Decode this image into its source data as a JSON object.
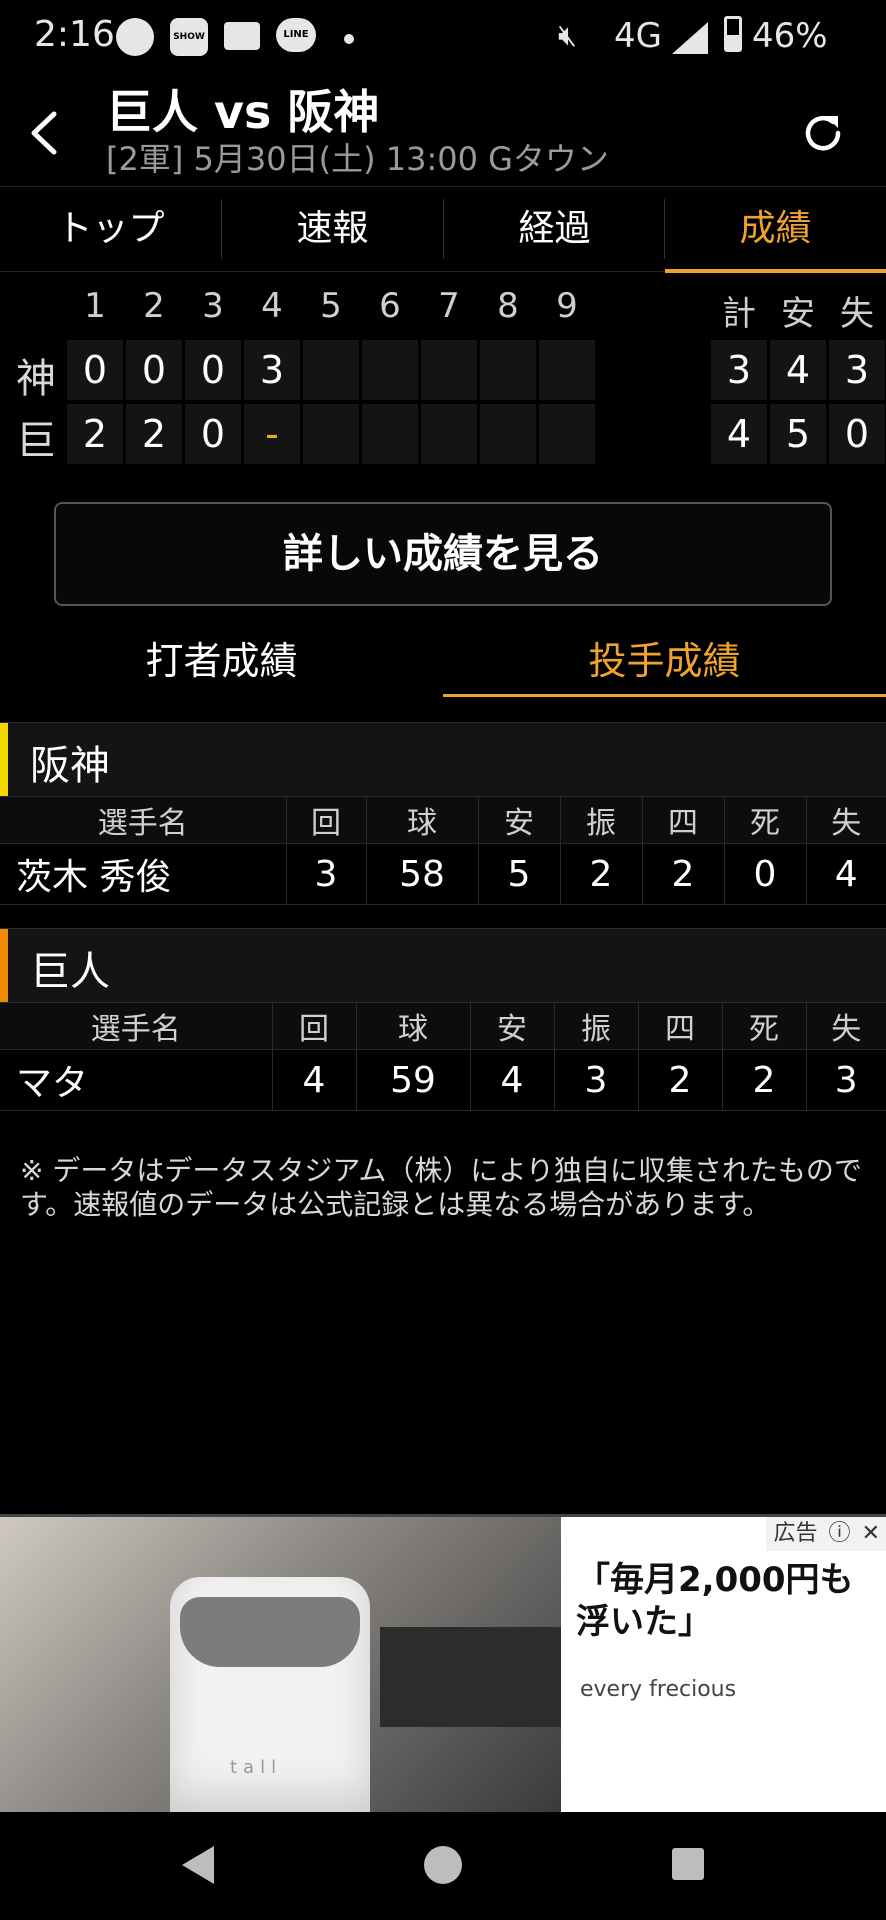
{
  "status_bar": {
    "time": "2:16",
    "network": "4G",
    "battery": "46%",
    "app_badges": [
      "SHOW ROOM",
      "au",
      "LINE"
    ]
  },
  "header": {
    "title": "巨人 vs 阪神",
    "subtitle": "[2軍] 5月30日(土) 13:00 Gタウン"
  },
  "tabs": [
    {
      "label": "トップ",
      "active": false
    },
    {
      "label": "速報",
      "active": false
    },
    {
      "label": "経過",
      "active": false
    },
    {
      "label": "成績",
      "active": true
    }
  ],
  "scoreboard": {
    "innings": [
      "1",
      "2",
      "3",
      "4",
      "5",
      "6",
      "7",
      "8",
      "9"
    ],
    "totals_headers": [
      "計",
      "安",
      "失"
    ],
    "rows": [
      {
        "team": "神",
        "scores": [
          "0",
          "0",
          "0",
          "3",
          "",
          "",
          "",
          "",
          ""
        ],
        "totals": [
          "3",
          "4",
          "3"
        ]
      },
      {
        "team": "巨",
        "scores": [
          "2",
          "2",
          "0",
          "-",
          "",
          "",
          "",
          "",
          ""
        ],
        "totals": [
          "4",
          "5",
          "0"
        ]
      }
    ]
  },
  "detail_button": "詳しい成績を見る",
  "sub_tabs": [
    {
      "label": "打者成績",
      "active": false
    },
    {
      "label": "投手成績",
      "active": true
    }
  ],
  "pitching": [
    {
      "team": "阪神",
      "color": "#f5d800",
      "headers": [
        "選手名",
        "回",
        "球",
        "安",
        "振",
        "四",
        "死",
        "失"
      ],
      "rows": [
        {
          "name": "茨木 秀俊",
          "stats": [
            "3",
            "58",
            "5",
            "2",
            "2",
            "0",
            "4"
          ]
        }
      ]
    },
    {
      "team": "巨人",
      "color": "#f08a00",
      "headers": [
        "選手名",
        "回",
        "球",
        "安",
        "振",
        "四",
        "死",
        "失"
      ],
      "rows": [
        {
          "name": "マタ",
          "stats": [
            "4",
            "59",
            "4",
            "3",
            "2",
            "2",
            "3"
          ]
        }
      ]
    }
  ],
  "note": "※ データはデータスタジアム（株）により独自に収集されたものです。速報値のデータは公式記録とは異なる場合があります。",
  "ad": {
    "label": "広告",
    "headline": "「毎月2,000円も浮いた」",
    "brand": "every frecious",
    "product_text": "tall"
  },
  "accent_color": "#f0a32c"
}
